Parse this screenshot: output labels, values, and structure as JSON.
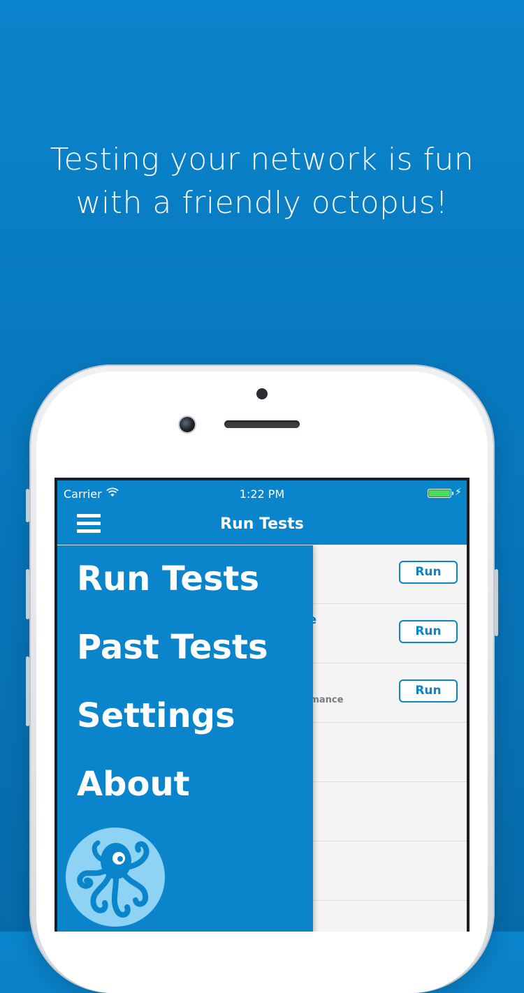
{
  "headline": {
    "line1": "Testing your network is fun",
    "line2": "with a friendly octopus!"
  },
  "status_bar": {
    "carrier": "Carrier",
    "time": "1:22 PM",
    "battery_color": "#4cd964"
  },
  "nav": {
    "title": "Run Tests",
    "menu_icon": "hamburger-icon"
  },
  "drawer": {
    "items": [
      {
        "label": "Run Tests"
      },
      {
        "label": "Past Tests"
      },
      {
        "label": "Settings"
      },
      {
        "label": "About"
      }
    ],
    "logo_icon": "octopus-logo"
  },
  "test_rows": [
    {
      "title_fragment": "",
      "subtitle_fragment": "",
      "button": "Run"
    },
    {
      "title_fragment": "ne",
      "subtitle_fragment": "",
      "button": "Run"
    },
    {
      "title_fragment": "",
      "subtitle_fragment": "ormance",
      "button": "Run"
    },
    {
      "title_fragment": "",
      "subtitle_fragment": "",
      "button": ""
    },
    {
      "title_fragment": "",
      "subtitle_fragment": "",
      "button": ""
    },
    {
      "title_fragment": "",
      "subtitle_fragment": "",
      "button": ""
    }
  ],
  "colors": {
    "brand_blue": "#0a85cc",
    "background_gradient_top": "#0a84cc",
    "logo_light_blue": "#8fd3f4",
    "logo_dark_blue": "#0a85cc"
  }
}
